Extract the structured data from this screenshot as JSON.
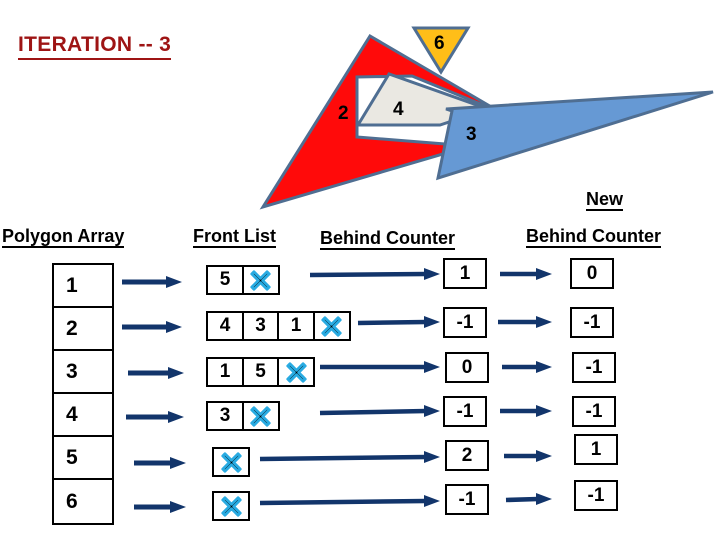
{
  "title": "ITERATION -- 3",
  "colors": {
    "title": "#9E1414",
    "arrow": "#12356B",
    "poly_red": "#FF0A0A",
    "poly_blue": "#6699D4",
    "poly_white": "#EAE8E2",
    "poly_yellow": "#FFBE18",
    "poly_stroke": "#4F6E92",
    "x_outline": "#29ABE2",
    "x_fill": "#000000"
  },
  "polygons": [
    {
      "id": "poly-2",
      "label": "2",
      "fill": "#FF0A0A"
    },
    {
      "id": "poly-4",
      "label": "4",
      "fill": "#EAE8E2"
    },
    {
      "id": "poly-3",
      "label": "3",
      "fill": "#6699D4"
    },
    {
      "id": "poly-6",
      "label": "6",
      "fill": "#FFBE18"
    }
  ],
  "headers": {
    "polygon_array": "Polygon Array",
    "front_list": "Front List",
    "behind_counter": "Behind Counter",
    "new_word": "New",
    "new_behind_counter": "Behind Counter"
  },
  "polygon_array": [
    "1",
    "2",
    "3",
    "4",
    "5",
    "6"
  ],
  "front_list": [
    [
      "5",
      "x"
    ],
    [
      "4",
      "3",
      "1",
      "x"
    ],
    [
      "1",
      "5",
      "x"
    ],
    [
      "3",
      "x"
    ],
    [
      "x"
    ],
    [
      "x"
    ]
  ],
  "behind_counter": [
    "1",
    "-1",
    "0",
    "-1",
    "2",
    "-1"
  ],
  "new_behind_counter": [
    "0",
    "-1",
    "-1",
    "-1",
    "1",
    "-1"
  ],
  "icons": {
    "null_terminator": "x-icon"
  }
}
